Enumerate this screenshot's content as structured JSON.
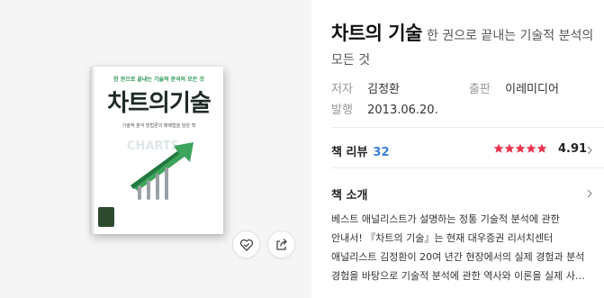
{
  "cover": {
    "subtitle_line": "한 권으로 끝내는 기술적 분석의 모든 것",
    "title": "차트의기술",
    "tagline": "기술적 분석 방법론의 매매법을 담은 책"
  },
  "actions": {
    "like_icon": "heart-check-icon",
    "share_icon": "share-icon"
  },
  "book": {
    "title": "차트의 기술",
    "subtitle": "한 권으로 끝내는 기술적 분석의 모든 것",
    "author_label": "저자",
    "author": "김정환",
    "publisher_label": "출판",
    "publisher": "이레미디어",
    "date_label": "발행",
    "date": "2013.06.20."
  },
  "review": {
    "label": "책 리뷰",
    "count": "32",
    "rating": "4.91",
    "stars": 5,
    "star_color": "#e8344e"
  },
  "intro": {
    "label": "책 소개",
    "text": "베스트 애널리스트가 설명하는 정통 기술적 분석에 관한 안내서! 『차트의 기술』는 현재 대우증권 리서치센터 애널리스트 김정환이 20여 년간 현장에서의 실제 경험과 분석 경험을 바탕으로 기술적 분석에 관한 역사와 이론을 실제 사…"
  },
  "colors": {
    "accent_blue": "#3a7de0",
    "cover_green": "#2f9a57"
  }
}
